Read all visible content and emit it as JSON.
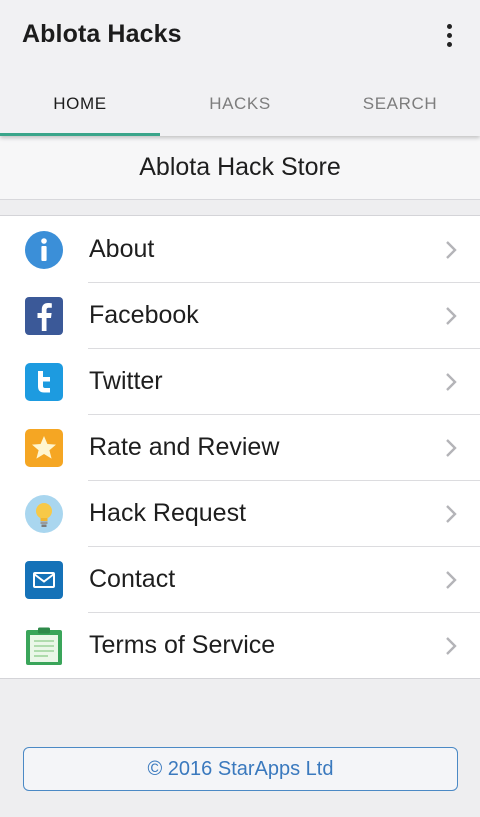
{
  "app": {
    "title": "Ablota Hacks"
  },
  "tabs": [
    {
      "label": "HOME",
      "active": true
    },
    {
      "label": "HACKS",
      "active": false
    },
    {
      "label": "SEARCH",
      "active": false
    }
  ],
  "header": {
    "store_title": "Ablota Hack Store"
  },
  "menu": [
    {
      "label": "About",
      "icon": "info-icon"
    },
    {
      "label": "Facebook",
      "icon": "facebook-icon"
    },
    {
      "label": "Twitter",
      "icon": "twitter-icon"
    },
    {
      "label": "Rate and Review",
      "icon": "star-icon"
    },
    {
      "label": "Hack Request",
      "icon": "lightbulb-icon"
    },
    {
      "label": "Contact",
      "icon": "mail-icon"
    },
    {
      "label": "Terms of Service",
      "icon": "clipboard-icon"
    }
  ],
  "footer": {
    "copyright": "© 2016 StarApps Ltd"
  },
  "colors": {
    "accent": "#3aa58a",
    "link": "#3a79be",
    "info": "#3b8fd8",
    "facebook": "#3b5998",
    "twitter": "#1d9be0",
    "star": "#f5a623",
    "mail": "#1572b8",
    "clipboard": "#3aa55a"
  }
}
